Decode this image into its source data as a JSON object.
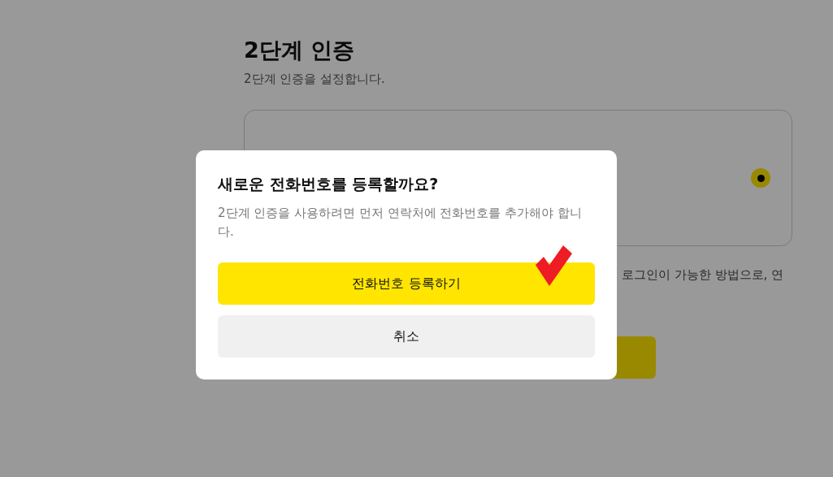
{
  "page": {
    "title": "2단계 인증",
    "subtitle": "2단계 인증을 설정합니다.",
    "option": {
      "selected": true
    },
    "note": "로그인이 가능한 방법으로, 연"
  },
  "dialog": {
    "title": "새로운 전화번호를 등록할까요?",
    "message": "2단계 인증을 사용하려면 먼저 연락처에 전화번호를 추가해야 합니다.",
    "buttons": [
      {
        "label": "전화번호 등록하기",
        "kind": "primary"
      },
      {
        "label": "취소",
        "kind": "secondary"
      }
    ]
  }
}
